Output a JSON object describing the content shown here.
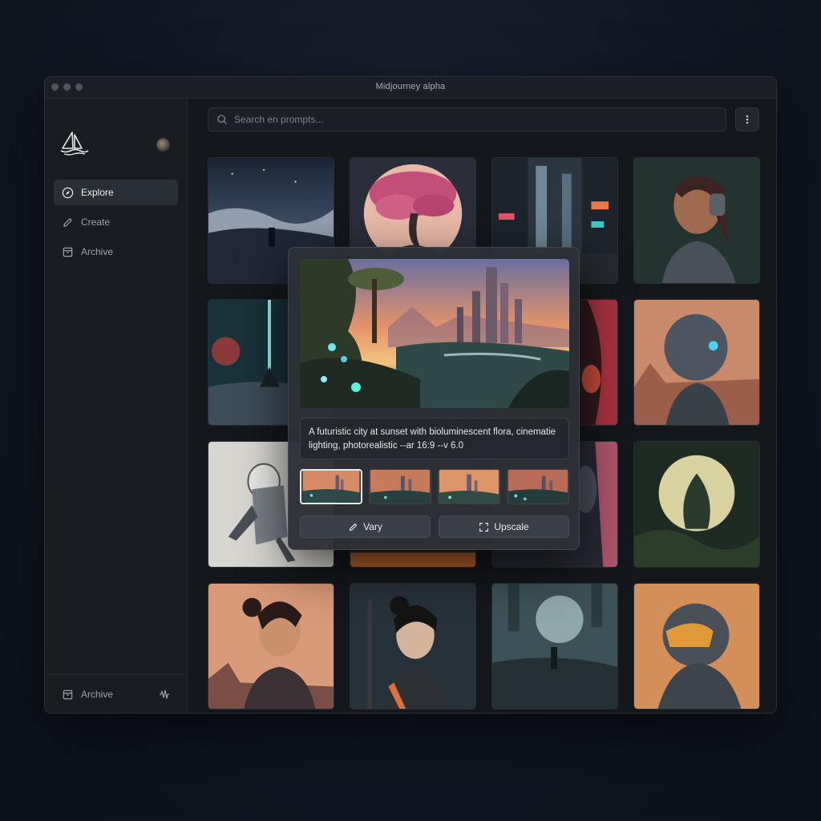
{
  "window": {
    "title": "Midjourney alpha"
  },
  "sidebar": {
    "items": [
      {
        "label": "Explore",
        "icon": "compass-icon",
        "active": true
      },
      {
        "label": "Create",
        "icon": "pencil-icon",
        "active": false
      },
      {
        "label": "Archive",
        "icon": "archive-icon",
        "active": false
      }
    ],
    "bottom_item": {
      "label": "Archive",
      "icon": "archive-icon"
    }
  },
  "search": {
    "placeholder": "Search en prompts..."
  },
  "preview": {
    "prompt": "A futuristic city at sunset with bioluminescent flora, cinematie lighting, photorealistic --ar 16:9 --v 6.0",
    "vary_label": "Vary",
    "upscale_label": "Upscale",
    "selected_variation": 1
  },
  "colors": {
    "accent": "#e8eaee",
    "background": "#14171c"
  }
}
